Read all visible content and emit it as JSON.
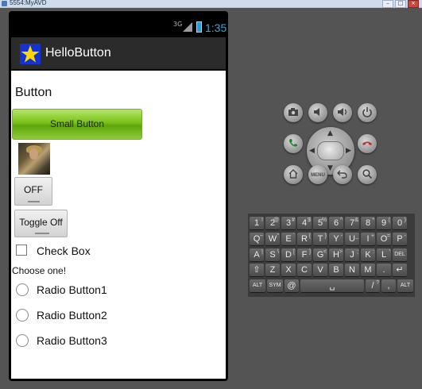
{
  "window": {
    "title": "5554:MyAVD"
  },
  "status_bar": {
    "network": "3G",
    "time": "1:35"
  },
  "app": {
    "title": "HelloButton"
  },
  "content": {
    "heading": "Button",
    "small_button": "Small Button",
    "toggle1": "OFF",
    "toggle2": "Toggle Off",
    "checkbox": "Check Box",
    "choose_label": "Choose one!",
    "radios": [
      "Radio Button1",
      "Radio Button2",
      "Radio Button3"
    ]
  },
  "keyboard": {
    "row1": [
      {
        "k": "1",
        "s": "!"
      },
      {
        "k": "2",
        "s": "@"
      },
      {
        "k": "3",
        "s": "#"
      },
      {
        "k": "4",
        "s": "$"
      },
      {
        "k": "5",
        "s": "%"
      },
      {
        "k": "6",
        "s": "^"
      },
      {
        "k": "7",
        "s": "&"
      },
      {
        "k": "8",
        "s": "*"
      },
      {
        "k": "9",
        "s": "("
      },
      {
        "k": "0",
        "s": ")"
      }
    ],
    "row2": [
      {
        "k": "Q",
        "s": "~"
      },
      {
        "k": "W",
        "s": "\""
      },
      {
        "k": "E",
        "s": "`"
      },
      {
        "k": "R",
        "s": "{"
      },
      {
        "k": "T",
        "s": "}"
      },
      {
        "k": "Y",
        "s": "-"
      },
      {
        "k": "U",
        "s": "_"
      },
      {
        "k": "I",
        "s": "+"
      },
      {
        "k": "O",
        "s": "="
      },
      {
        "k": "P",
        "s": "-"
      }
    ],
    "row3": [
      {
        "k": "A",
        "s": "|"
      },
      {
        "k": "S",
        "s": "\\"
      },
      {
        "k": "D",
        "s": "["
      },
      {
        "k": "F",
        "s": "]"
      },
      {
        "k": "G",
        "s": "<"
      },
      {
        "k": "H",
        "s": ">"
      },
      {
        "k": "J",
        "s": ";"
      },
      {
        "k": "K",
        "s": ":"
      },
      {
        "k": "L",
        "s": "'"
      },
      {
        "k": "DEL",
        "s": ""
      }
    ],
    "row4": [
      {
        "k": "⇧",
        "s": ""
      },
      {
        "k": "Z",
        "s": ""
      },
      {
        "k": "X",
        "s": ""
      },
      {
        "k": "C",
        "s": ""
      },
      {
        "k": "V",
        "s": ""
      },
      {
        "k": "B",
        "s": ""
      },
      {
        "k": "N",
        "s": ""
      },
      {
        "k": "M",
        "s": ""
      },
      {
        "k": ".",
        "s": ""
      },
      {
        "k": "↵",
        "s": ""
      }
    ],
    "row5": [
      {
        "k": "ALT",
        "s": ""
      },
      {
        "k": "SYM",
        "s": ""
      },
      {
        "k": "@",
        "s": ""
      },
      {
        "k": "␣",
        "s": ""
      },
      {
        "k": "/",
        "s": "?"
      },
      {
        "k": ",",
        "s": ""
      },
      {
        "k": "ALT",
        "s": ""
      }
    ]
  },
  "hardware_buttons": [
    "camera-icon",
    "volume-down-icon",
    "volume-up-icon",
    "power-icon",
    "call-icon",
    "end-call-icon",
    "home-icon",
    "menu-icon",
    "back-icon",
    "search-icon"
  ],
  "colors": {
    "time": "#34a8e0",
    "small_button": "#79c018",
    "app_icon_bg": "#1533cf",
    "star": "#ffd800"
  }
}
